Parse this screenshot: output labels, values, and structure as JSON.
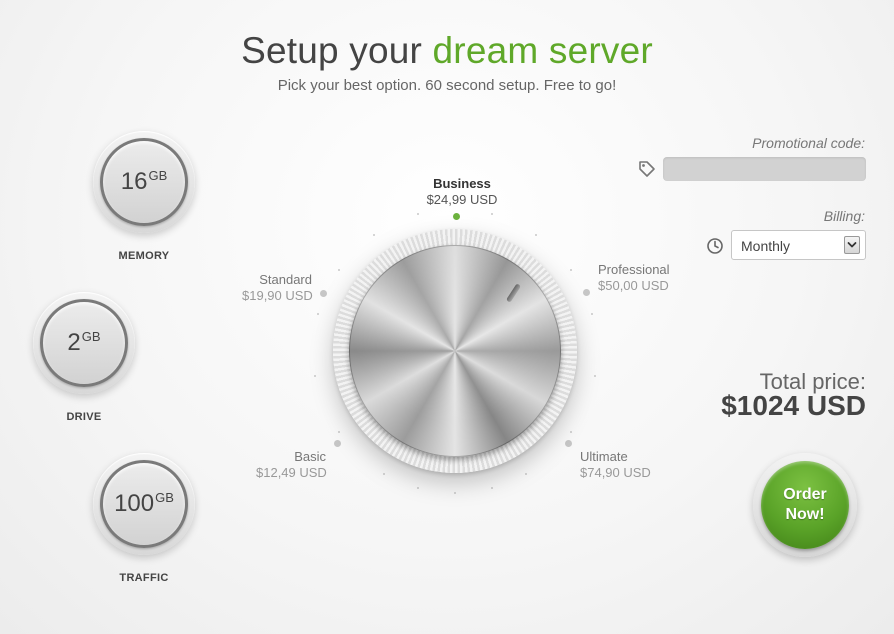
{
  "header": {
    "title_prefix": "Setup your ",
    "title_accent": "dream server",
    "subtitle": "Pick your best option. 60 second setup. Free to go!"
  },
  "specs": [
    {
      "value": "16",
      "unit": "GB",
      "label": "MEMORY"
    },
    {
      "value": "2",
      "unit": "GB",
      "label": "DRIVE"
    },
    {
      "value": "100",
      "unit": "GB",
      "label": "TRAFFIC"
    }
  ],
  "plans": {
    "business": {
      "name": "Business",
      "price": "$24,99 USD"
    },
    "standard": {
      "name": "Standard",
      "price": "$19,90 USD"
    },
    "professional": {
      "name": "Professional",
      "price": "$50,00 USD"
    },
    "basic": {
      "name": "Basic",
      "price": "$12,49 USD"
    },
    "ultimate": {
      "name": "Ultimate",
      "price": "$74,90 USD"
    },
    "selected": "business"
  },
  "promo": {
    "label": "Promotional code:",
    "value": ""
  },
  "billing": {
    "label": "Billing:",
    "selected": "Monthly"
  },
  "total": {
    "label": "Total price:",
    "value": "$1024 USD"
  },
  "order": {
    "label_line1": "Order",
    "label_line2": "Now!"
  },
  "colors": {
    "accent": "#5fa829",
    "active_dot": "#6db33f",
    "order_button": "#5aa328"
  },
  "icons": {
    "promo": "tag-icon",
    "billing": "clock-icon",
    "select": "chevron-down-icon"
  }
}
